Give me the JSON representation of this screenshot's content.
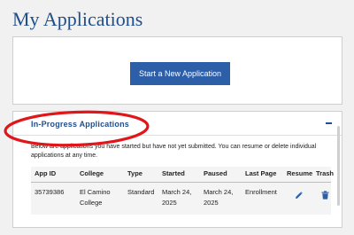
{
  "page": {
    "title": "My Applications"
  },
  "start": {
    "button_label": "Start a New Application"
  },
  "in_progress": {
    "title": "In-Progress Applications",
    "collapse_icon": "minus-icon",
    "description": "Below are applications you have started but have not yet submitted. You can resume or delete individual applications at any time.",
    "columns": [
      "App ID",
      "College",
      "Type",
      "Started",
      "Paused",
      "Last Page",
      "Resume",
      "Trash"
    ],
    "rows": [
      {
        "app_id": "35739386",
        "college": "El Camino College",
        "type": "Standard",
        "started": "March 24, 2025",
        "paused": "March 24, 2025",
        "last_page": "Enrollment",
        "resume_icon": "pencil-icon",
        "trash_icon": "trash-icon"
      }
    ]
  },
  "colors": {
    "primary_blue": "#1f4e8c",
    "button_blue": "#2d5ea8",
    "annotation_red": "#e0161b",
    "background": "#f1f1f1"
  }
}
